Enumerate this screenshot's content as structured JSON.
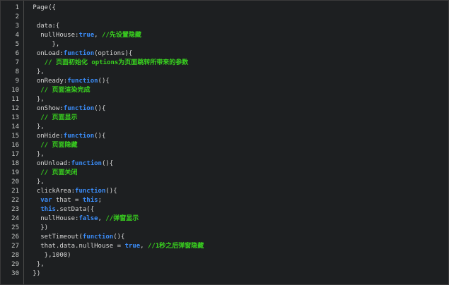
{
  "editor": {
    "colors": {
      "background": "#1d1f21",
      "plain": "#d6d6d6",
      "keyword": "#3b8dfa",
      "comment": "#39d21f",
      "line_number": "#c5c8c6"
    },
    "lines": [
      {
        "n": "1",
        "tokens": [
          {
            "t": "plain",
            "v": " Page({"
          }
        ]
      },
      {
        "n": "2",
        "tokens": []
      },
      {
        "n": "3",
        "tokens": [
          {
            "t": "plain",
            "v": "  data:{"
          }
        ]
      },
      {
        "n": "4",
        "tokens": [
          {
            "t": "plain",
            "v": "   nullHouse:"
          },
          {
            "t": "kw",
            "v": "true"
          },
          {
            "t": "plain",
            "v": ", "
          },
          {
            "t": "cm",
            "v": "//先设置隐藏"
          }
        ]
      },
      {
        "n": "5",
        "tokens": [
          {
            "t": "plain",
            "v": "      },"
          }
        ]
      },
      {
        "n": "6",
        "tokens": [
          {
            "t": "plain",
            "v": "  onLoad:"
          },
          {
            "t": "kw",
            "v": "function"
          },
          {
            "t": "plain",
            "v": "(options){"
          }
        ]
      },
      {
        "n": "7",
        "tokens": [
          {
            "t": "plain",
            "v": "    "
          },
          {
            "t": "cm",
            "v": "// 页面初始化 options为页面跳转所带来的参数"
          }
        ]
      },
      {
        "n": "8",
        "tokens": [
          {
            "t": "plain",
            "v": "  },"
          }
        ]
      },
      {
        "n": "9",
        "tokens": [
          {
            "t": "plain",
            "v": "  onReady:"
          },
          {
            "t": "kw",
            "v": "function"
          },
          {
            "t": "plain",
            "v": "(){"
          }
        ]
      },
      {
        "n": "10",
        "tokens": [
          {
            "t": "plain",
            "v": "   "
          },
          {
            "t": "cm",
            "v": "// 页面渲染完成"
          }
        ]
      },
      {
        "n": "11",
        "tokens": [
          {
            "t": "plain",
            "v": "  },"
          }
        ]
      },
      {
        "n": "12",
        "tokens": [
          {
            "t": "plain",
            "v": "  onShow:"
          },
          {
            "t": "kw",
            "v": "function"
          },
          {
            "t": "plain",
            "v": "(){"
          }
        ]
      },
      {
        "n": "13",
        "tokens": [
          {
            "t": "plain",
            "v": "   "
          },
          {
            "t": "cm",
            "v": "// 页面显示"
          }
        ]
      },
      {
        "n": "14",
        "tokens": [
          {
            "t": "plain",
            "v": "  },"
          }
        ]
      },
      {
        "n": "15",
        "tokens": [
          {
            "t": "plain",
            "v": "  onHide:"
          },
          {
            "t": "kw",
            "v": "function"
          },
          {
            "t": "plain",
            "v": "(){"
          }
        ]
      },
      {
        "n": "16",
        "tokens": [
          {
            "t": "plain",
            "v": "   "
          },
          {
            "t": "cm",
            "v": "// 页面隐藏"
          }
        ]
      },
      {
        "n": "17",
        "tokens": [
          {
            "t": "plain",
            "v": "  },"
          }
        ]
      },
      {
        "n": "18",
        "tokens": [
          {
            "t": "plain",
            "v": "  onUnload:"
          },
          {
            "t": "kw",
            "v": "function"
          },
          {
            "t": "plain",
            "v": "(){"
          }
        ]
      },
      {
        "n": "19",
        "tokens": [
          {
            "t": "plain",
            "v": "   "
          },
          {
            "t": "cm",
            "v": "// 页面关闭"
          }
        ]
      },
      {
        "n": "20",
        "tokens": [
          {
            "t": "plain",
            "v": "  },"
          }
        ]
      },
      {
        "n": "21",
        "tokens": [
          {
            "t": "plain",
            "v": "  clickArea:"
          },
          {
            "t": "kw",
            "v": "function"
          },
          {
            "t": "plain",
            "v": "(){"
          }
        ]
      },
      {
        "n": "22",
        "tokens": [
          {
            "t": "plain",
            "v": "   "
          },
          {
            "t": "kw",
            "v": "var"
          },
          {
            "t": "plain",
            "v": " that = "
          },
          {
            "t": "kw",
            "v": "this"
          },
          {
            "t": "plain",
            "v": ";"
          }
        ]
      },
      {
        "n": "23",
        "tokens": [
          {
            "t": "plain",
            "v": "   "
          },
          {
            "t": "kw",
            "v": "this"
          },
          {
            "t": "plain",
            "v": ".setData({"
          }
        ]
      },
      {
        "n": "24",
        "tokens": [
          {
            "t": "plain",
            "v": "   nullHouse:"
          },
          {
            "t": "kw",
            "v": "false"
          },
          {
            "t": "plain",
            "v": ", "
          },
          {
            "t": "cm",
            "v": "//弹窗显示"
          }
        ]
      },
      {
        "n": "25",
        "tokens": [
          {
            "t": "plain",
            "v": "   })"
          }
        ]
      },
      {
        "n": "26",
        "tokens": [
          {
            "t": "plain",
            "v": "   setTimeout("
          },
          {
            "t": "kw",
            "v": "function"
          },
          {
            "t": "plain",
            "v": "(){"
          }
        ]
      },
      {
        "n": "27",
        "tokens": [
          {
            "t": "plain",
            "v": "   that.data.nullHouse = "
          },
          {
            "t": "kw",
            "v": "true"
          },
          {
            "t": "plain",
            "v": ", "
          },
          {
            "t": "cm",
            "v": "//1秒之后弹窗隐藏"
          }
        ]
      },
      {
        "n": "28",
        "tokens": [
          {
            "t": "plain",
            "v": "    },1000)"
          }
        ]
      },
      {
        "n": "29",
        "tokens": [
          {
            "t": "plain",
            "v": "  },"
          }
        ]
      },
      {
        "n": "30",
        "tokens": [
          {
            "t": "plain",
            "v": " })"
          }
        ]
      }
    ]
  }
}
